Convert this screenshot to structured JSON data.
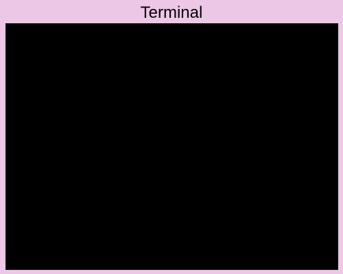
{
  "window": {
    "title": "Terminal"
  },
  "colors": {
    "frame": "#ecc8e6",
    "terminal_background": "#000000",
    "title_text": "#000000"
  }
}
